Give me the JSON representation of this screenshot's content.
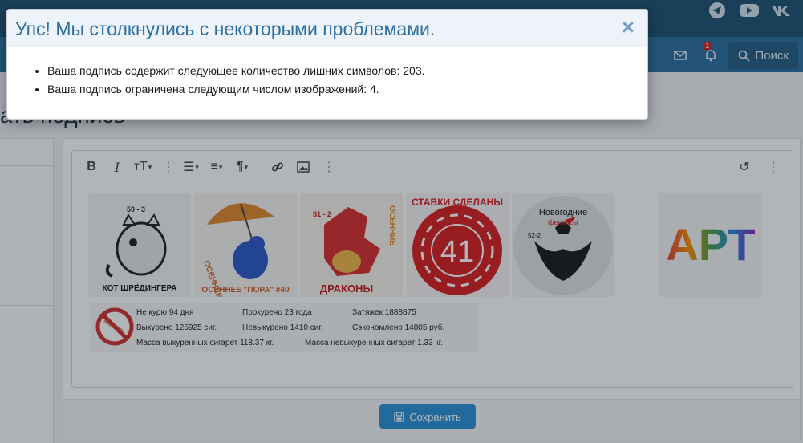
{
  "header": {
    "social_icons": [
      "telegram-icon",
      "youtube-icon",
      "vk-icon"
    ],
    "badge_count": "1",
    "search_label": "Поиск"
  },
  "page": {
    "title_fragment": "ать подпись"
  },
  "editor": {
    "toolbar_icons": [
      "bold-icon",
      "italic-icon",
      "text-size-icon",
      "more-icon",
      "list-icon",
      "align-icon",
      "paragraph-icon",
      "link-icon",
      "image-icon",
      "more-icon",
      "undo-icon",
      "more-icon"
    ],
    "images": [
      {
        "name": "cat-schrodinger-image",
        "caption": "КОТ ШРЁДИНГЕРА",
        "tag": "50 - 3"
      },
      {
        "name": "autumn-pora-image",
        "caption": "ОСЕННЕЕ \"ПОРА\" #40"
      },
      {
        "name": "autumn-dragons-image",
        "caption": "ДРАКОНЫ",
        "side": "ОСЕННИЕ",
        "tag": "51 - 2"
      },
      {
        "name": "bets-made-image",
        "caption": "СТАВКИ СДЕЛАНЫ",
        "number": "41"
      },
      {
        "name": "new-year-phoenix-image",
        "caption": "Новогодние",
        "sub": "фениксы",
        "tag": "52-2"
      },
      {
        "name": "art-image",
        "caption": "АРТ"
      }
    ],
    "smoke": {
      "line1": [
        "Не курю 94 дня",
        "Прокурено 23 года",
        "Затяжек 1888875"
      ],
      "line2": [
        "Выкурено 125925 сиг.",
        "Невыкурено 1410 сиг.",
        "Сэкономлено 14805 руб."
      ],
      "line3": [
        "Масса выкуренных сигарет 118.37 кг.",
        "Масса невыкуренных сигарет 1.33 кг."
      ]
    },
    "save_label": "Сохранить"
  },
  "modal": {
    "title": "Упс! Мы столкнулись с некоторыми проблемами.",
    "close": "×",
    "errors": [
      "Ваша подпись содержит следующее количество лишних символов: 203.",
      "Ваша подпись ограничена следующим числом изображений: 4."
    ]
  }
}
